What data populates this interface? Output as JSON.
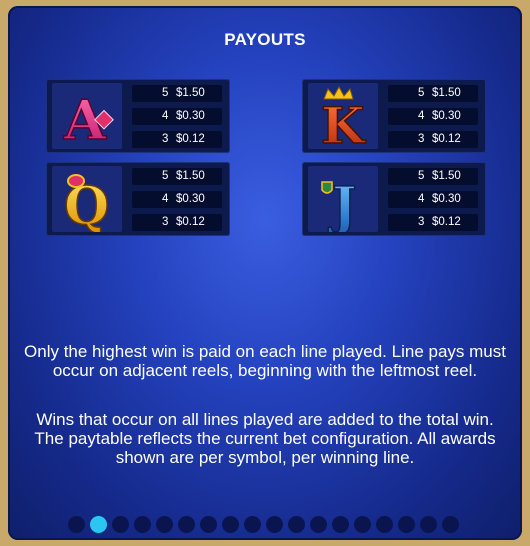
{
  "title": "PAYOUTS",
  "symbols": [
    {
      "name": "A",
      "pays": [
        {
          "count": "5",
          "amount": "$1.50"
        },
        {
          "count": "4",
          "amount": "$0.30"
        },
        {
          "count": "3",
          "amount": "$0.12"
        }
      ]
    },
    {
      "name": "K",
      "pays": [
        {
          "count": "5",
          "amount": "$1.50"
        },
        {
          "count": "4",
          "amount": "$0.30"
        },
        {
          "count": "3",
          "amount": "$0.12"
        }
      ]
    },
    {
      "name": "Q",
      "pays": [
        {
          "count": "5",
          "amount": "$1.50"
        },
        {
          "count": "4",
          "amount": "$0.30"
        },
        {
          "count": "3",
          "amount": "$0.12"
        }
      ]
    },
    {
      "name": "J",
      "pays": [
        {
          "count": "5",
          "amount": "$1.50"
        },
        {
          "count": "4",
          "amount": "$0.30"
        },
        {
          "count": "3",
          "amount": "$0.12"
        }
      ]
    }
  ],
  "rules": [
    "Only the highest win is paid on each line played. Line pays must occur on adjacent reels, beginning with the leftmost reel.",
    "Wins that occur on all lines played are added to the total win. The paytable reflects the current bet configuration. All awards shown are per symbol, per winning line."
  ],
  "pagination": {
    "total": 18,
    "current": 2
  },
  "colors": {
    "panel": "#2543c0",
    "active_dot": "#2bc6f2",
    "dot": "#0a1550"
  }
}
